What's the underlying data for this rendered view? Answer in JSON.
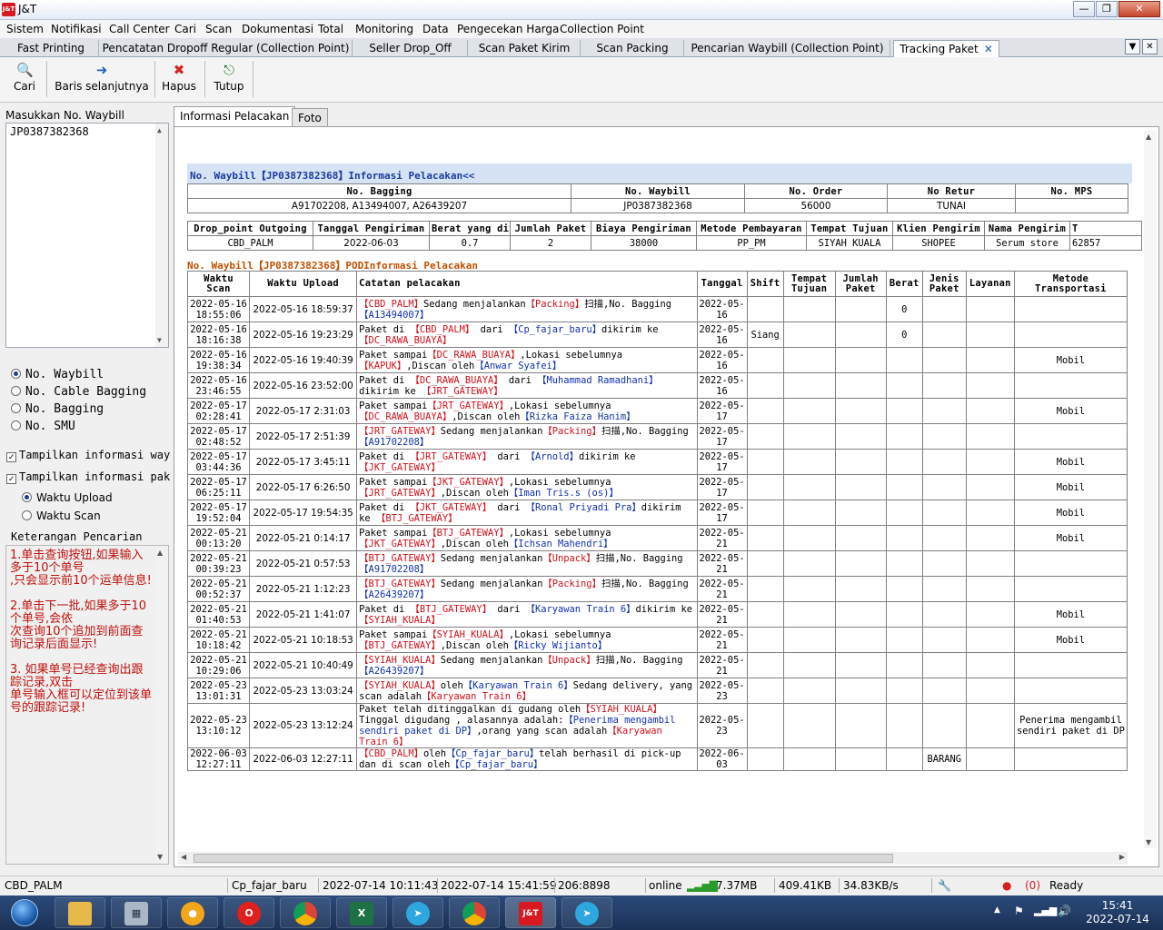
{
  "window": {
    "title": "J&T",
    "logo": "J&T"
  },
  "menu": [
    "Sistem",
    "Notifikasi",
    "Call Center",
    "Cari",
    "Scan",
    "Dokumentasi",
    "Total",
    "Monitoring",
    "Data",
    "Pengecekan Harga",
    "Collection Point"
  ],
  "doc_tabs": [
    "Fast Printing",
    "Pencatatan Dropoff Regular (Collection Point)",
    "Seller Drop_Off",
    "Scan Paket Kirim",
    "Scan Packing",
    "Pencarian Waybill (Collection Point)",
    "Tracking Paket"
  ],
  "toolbar": {
    "cari": "Cari",
    "baris": "Baris selanjutnya",
    "hapus": "Hapus",
    "tutup": "Tutup"
  },
  "left": {
    "label": "Masukkan No. Waybill",
    "input_value": "JP0387382368",
    "radio1": [
      "No. Waybill",
      "No. Cable Bagging",
      "No. Bagging",
      "No. SMU"
    ],
    "check1": "Tampilkan informasi waybill",
    "check2": "Tampilkan informasi paket",
    "radio2": [
      "Waktu Upload",
      "Waktu Scan"
    ],
    "hint_title": "Keterangan Pencarian",
    "hint_text": "1.单击查询按钮,如果输入多于10个单号\n,只会显示前10个运单信息!\n\n2.单击下一批,如果多于10个单号,会依\n次查询10个追加到前面查询记录后面显示!\n\n3. 如果单号已经查询出跟踪记录,双击\n单号输入框可以定位到该单号的跟踪记录!"
  },
  "inner_tabs": [
    "Informasi Pelacakan",
    "Foto"
  ],
  "section1_title": "No. Waybill【JP0387382368】Informasi Pelacakan<<",
  "info1": {
    "headers": [
      "No. Bagging",
      "No. Waybill",
      "No. Order",
      "No Retur",
      "No. MPS"
    ],
    "values": [
      "A91702208, A13494007, A26439207",
      "JP0387382368",
      "56000",
      "TUNAI",
      ""
    ]
  },
  "info2": {
    "headers": [
      "Drop_point Outgoing",
      "Tanggal Pengiriman",
      "Berat yang ditagih",
      "Jumlah Paket",
      "Biaya Pengiriman",
      "Metode Pembayaran",
      "Tempat Tujuan",
      "Klien Pengirim",
      "Nama Pengirim",
      "T"
    ],
    "values": [
      "CBD_PALM",
      "2022-06-03",
      "0.7",
      "2",
      "38000",
      "PP_PM",
      "SIYAH KUALA",
      "SHOPEE",
      "Serum store",
      "62857"
    ]
  },
  "section2_title": "No. Waybill【JP0387382368】PODInformasi Pelacakan",
  "tracking": {
    "headers": [
      "Waktu Scan",
      "Waktu Upload",
      "Catatan pelacakan",
      "Tanggal",
      "Shift",
      "Tempat Tujuan",
      "Jumlah Paket",
      "Berat",
      "Jenis Paket",
      "Layanan",
      "Metode Transportasi"
    ],
    "rows": [
      {
        "scan": "2022-05-16 18:55:06",
        "upload": "2022-05-16 18:59:37",
        "note": [
          [
            "r",
            "【CBD_PALM】"
          ],
          [
            "",
            "Sedang menjalankan"
          ],
          [
            "r",
            "【Packing】"
          ],
          [
            "",
            "扫描,No. Bagging"
          ],
          [
            "b",
            "【A13494007】"
          ]
        ],
        "tanggal": "2022-05-16",
        "shift": "",
        "tujuan": "",
        "jumlah": "",
        "berat": "0",
        "jenis": "",
        "layanan": "",
        "metode": ""
      },
      {
        "scan": "2022-05-16 18:16:38",
        "upload": "2022-05-16 19:23:29",
        "note": [
          [
            "",
            "Paket di "
          ],
          [
            "r",
            "【CBD_PALM】"
          ],
          [
            "",
            " dari "
          ],
          [
            "b",
            "【Cp_fajar_baru】"
          ],
          [
            "",
            "dikirim ke "
          ],
          [
            "r",
            "【DC_RAWA_BUAYA】"
          ]
        ],
        "tanggal": "2022-05-16",
        "shift": "Siang",
        "tujuan": "",
        "jumlah": "",
        "berat": "0",
        "jenis": "",
        "layanan": "",
        "metode": ""
      },
      {
        "scan": "2022-05-16 19:38:34",
        "upload": "2022-05-16 19:40:39",
        "note": [
          [
            "",
            "Paket sampai"
          ],
          [
            "r",
            "【DC_RAWA_BUAYA】"
          ],
          [
            "",
            ",Lokasi sebelumnya "
          ],
          [
            "r",
            "【KAPUK】"
          ],
          [
            "",
            ",Discan oleh"
          ],
          [
            "b",
            "【Anwar Syafei】"
          ]
        ],
        "tanggal": "2022-05-16",
        "shift": "",
        "tujuan": "",
        "jumlah": "",
        "berat": "",
        "jenis": "",
        "layanan": "",
        "metode": "Mobil"
      },
      {
        "scan": "2022-05-16 23:46:55",
        "upload": "2022-05-16 23:52:00",
        "note": [
          [
            "",
            "Paket di "
          ],
          [
            "r",
            "【DC_RAWA_BUAYA】"
          ],
          [
            "",
            " dari "
          ],
          [
            "b",
            "【Muhammad Ramadhani】"
          ],
          [
            "",
            "dikirim ke "
          ],
          [
            "r",
            "【JRT_GATEWAY】"
          ]
        ],
        "tanggal": "2022-05-16",
        "shift": "",
        "tujuan": "",
        "jumlah": "",
        "berat": "",
        "jenis": "",
        "layanan": "",
        "metode": ""
      },
      {
        "scan": "2022-05-17 02:28:41",
        "upload": "2022-05-17 2:31:03",
        "note": [
          [
            "",
            "Paket sampai"
          ],
          [
            "r",
            "【JRT_GATEWAY】"
          ],
          [
            "",
            ",Lokasi sebelumnya "
          ],
          [
            "r",
            "【DC_RAWA_BUAYA】"
          ],
          [
            "",
            ",Discan oleh"
          ],
          [
            "b",
            "【Rizka Faiza Hanim】"
          ]
        ],
        "tanggal": "2022-05-17",
        "shift": "",
        "tujuan": "",
        "jumlah": "",
        "berat": "",
        "jenis": "",
        "layanan": "",
        "metode": "Mobil"
      },
      {
        "scan": "2022-05-17 02:48:52",
        "upload": "2022-05-17 2:51:39",
        "note": [
          [
            "r",
            "【JRT_GATEWAY】"
          ],
          [
            "",
            "Sedang menjalankan"
          ],
          [
            "r",
            "【Packing】"
          ],
          [
            "",
            "扫描,No. Bagging"
          ],
          [
            "b",
            "【A91702208】"
          ]
        ],
        "tanggal": "2022-05-17",
        "shift": "",
        "tujuan": "",
        "jumlah": "",
        "berat": "",
        "jenis": "",
        "layanan": "",
        "metode": ""
      },
      {
        "scan": "2022-05-17 03:44:36",
        "upload": "2022-05-17 3:45:11",
        "note": [
          [
            "",
            "Paket di "
          ],
          [
            "r",
            "【JRT_GATEWAY】"
          ],
          [
            "",
            " dari "
          ],
          [
            "b",
            "【Arnold】"
          ],
          [
            "",
            "dikirim ke "
          ],
          [
            "r",
            "【JKT_GATEWAY】"
          ]
        ],
        "tanggal": "2022-05-17",
        "shift": "",
        "tujuan": "",
        "jumlah": "",
        "berat": "",
        "jenis": "",
        "layanan": "",
        "metode": "Mobil"
      },
      {
        "scan": "2022-05-17 06:25:11",
        "upload": "2022-05-17 6:26:50",
        "note": [
          [
            "",
            "Paket sampai"
          ],
          [
            "r",
            "【JKT_GATEWAY】"
          ],
          [
            "",
            ",Lokasi sebelumnya "
          ],
          [
            "r",
            "【JRT_GATEWAY】"
          ],
          [
            "",
            ",Discan oleh"
          ],
          [
            "b",
            "【Iman Tris.s (os)】"
          ]
        ],
        "tanggal": "2022-05-17",
        "shift": "",
        "tujuan": "",
        "jumlah": "",
        "berat": "",
        "jenis": "",
        "layanan": "",
        "metode": "Mobil"
      },
      {
        "scan": "2022-05-17 19:52:04",
        "upload": "2022-05-17 19:54:35",
        "note": [
          [
            "",
            "Paket di "
          ],
          [
            "r",
            "【JKT_GATEWAY】"
          ],
          [
            "",
            " dari "
          ],
          [
            "b",
            "【Ronal Priyadi Pra】"
          ],
          [
            "",
            "dikirim ke "
          ],
          [
            "r",
            "【BTJ_GATEWAY】"
          ]
        ],
        "tanggal": "2022-05-17",
        "shift": "",
        "tujuan": "",
        "jumlah": "",
        "berat": "",
        "jenis": "",
        "layanan": "",
        "metode": "Mobil"
      },
      {
        "scan": "2022-05-21 00:13:20",
        "upload": "2022-05-21 0:14:17",
        "note": [
          [
            "",
            "Paket sampai"
          ],
          [
            "r",
            "【BTJ_GATEWAY】"
          ],
          [
            "",
            ",Lokasi sebelumnya "
          ],
          [
            "r",
            "【JKT_GATEWAY】"
          ],
          [
            "",
            ",Discan oleh"
          ],
          [
            "b",
            "【Ichsan Mahendri】"
          ]
        ],
        "tanggal": "2022-05-21",
        "shift": "",
        "tujuan": "",
        "jumlah": "",
        "berat": "",
        "jenis": "",
        "layanan": "",
        "metode": "Mobil"
      },
      {
        "scan": "2022-05-21 00:39:23",
        "upload": "2022-05-21 0:57:53",
        "note": [
          [
            "r",
            "【BTJ_GATEWAY】"
          ],
          [
            "",
            "Sedang menjalankan"
          ],
          [
            "r",
            "【Unpack】"
          ],
          [
            "",
            "扫描,No. Bagging"
          ],
          [
            "b",
            "【A91702208】"
          ]
        ],
        "tanggal": "2022-05-21",
        "shift": "",
        "tujuan": "",
        "jumlah": "",
        "berat": "",
        "jenis": "",
        "layanan": "",
        "metode": ""
      },
      {
        "scan": "2022-05-21 00:52:37",
        "upload": "2022-05-21 1:12:23",
        "note": [
          [
            "r",
            "【BTJ_GATEWAY】"
          ],
          [
            "",
            "Sedang menjalankan"
          ],
          [
            "r",
            "【Packing】"
          ],
          [
            "",
            "扫描,No. Bagging"
          ],
          [
            "b",
            "【A26439207】"
          ]
        ],
        "tanggal": "2022-05-21",
        "shift": "",
        "tujuan": "",
        "jumlah": "",
        "berat": "",
        "jenis": "",
        "layanan": "",
        "metode": ""
      },
      {
        "scan": "2022-05-21 01:40:53",
        "upload": "2022-05-21 1:41:07",
        "note": [
          [
            "",
            "Paket di "
          ],
          [
            "r",
            "【BTJ_GATEWAY】"
          ],
          [
            "",
            " dari "
          ],
          [
            "b",
            "【Karyawan Train 6】"
          ],
          [
            "",
            "dikirim ke "
          ],
          [
            "r",
            "【SYIAH_KUALA】"
          ]
        ],
        "tanggal": "2022-05-21",
        "shift": "",
        "tujuan": "",
        "jumlah": "",
        "berat": "",
        "jenis": "",
        "layanan": "",
        "metode": "Mobil"
      },
      {
        "scan": "2022-05-21 10:18:42",
        "upload": "2022-05-21 10:18:53",
        "note": [
          [
            "",
            "Paket sampai"
          ],
          [
            "r",
            "【SYIAH_KUALA】"
          ],
          [
            "",
            ",Lokasi sebelumnya "
          ],
          [
            "r",
            "【BTJ_GATEWAY】"
          ],
          [
            "",
            ",Discan oleh"
          ],
          [
            "b",
            "【Ricky Wijianto】"
          ]
        ],
        "tanggal": "2022-05-21",
        "shift": "",
        "tujuan": "",
        "jumlah": "",
        "berat": "",
        "jenis": "",
        "layanan": "",
        "metode": "Mobil"
      },
      {
        "scan": "2022-05-21 10:29:06",
        "upload": "2022-05-21 10:40:49",
        "note": [
          [
            "r",
            "【SYIAH_KUALA】"
          ],
          [
            "",
            "Sedang menjalankan"
          ],
          [
            "r",
            "【Unpack】"
          ],
          [
            "",
            "扫描,No. Bagging"
          ],
          [
            "b",
            "【A26439207】"
          ]
        ],
        "tanggal": "2022-05-21",
        "shift": "",
        "tujuan": "",
        "jumlah": "",
        "berat": "",
        "jenis": "",
        "layanan": "",
        "metode": ""
      },
      {
        "scan": "2022-05-23 13:01:31",
        "upload": "2022-05-23 13:03:24",
        "note": [
          [
            "r",
            "【SYIAH_KUALA】"
          ],
          [
            "",
            "oleh"
          ],
          [
            "b",
            "【Karyawan Train 6】"
          ],
          [
            "",
            "Sedang delivery, yang scan adalah"
          ],
          [
            "r",
            "【Karyawan Train 6】"
          ]
        ],
        "tanggal": "2022-05-23",
        "shift": "",
        "tujuan": "",
        "jumlah": "",
        "berat": "",
        "jenis": "",
        "layanan": "",
        "metode": ""
      },
      {
        "scan": "2022-05-23 13:10:12",
        "upload": "2022-05-23 13:12:24",
        "note": [
          [
            "",
            "Paket telah ditinggalkan di gudang oleh"
          ],
          [
            "r",
            "【SYIAH_KUALA】"
          ],
          [
            "",
            "Tinggal digudang , alasannya adalah:"
          ],
          [
            "b",
            "【Penerima mengambil sendiri paket di DP】"
          ],
          [
            "",
            ",orang yang scan adalah"
          ],
          [
            "r",
            "【Karyawan Train 6】"
          ]
        ],
        "tanggal": "2022-05-23",
        "shift": "",
        "tujuan": "",
        "jumlah": "",
        "berat": "",
        "jenis": "",
        "layanan": "",
        "metode": "Penerima mengambil sendiri paket di DP"
      },
      {
        "scan": "2022-06-03 12:27:11",
        "upload": "2022-06-03 12:27:11",
        "note": [
          [
            "r",
            "【CBD_PALM】"
          ],
          [
            "",
            "oleh"
          ],
          [
            "b",
            "【Cp_fajar_baru】"
          ],
          [
            "",
            "telah berhasil di pick-up dan di scan oleh"
          ],
          [
            "b",
            "【Cp_fajar_baru】"
          ]
        ],
        "tanggal": "2022-06-03",
        "shift": "",
        "tujuan": "",
        "jumlah": "",
        "berat": "",
        "jenis": "BARANG",
        "layanan": "",
        "metode": ""
      }
    ]
  },
  "status": {
    "site": "CBD_PALM",
    "user": "Cp_fajar_baru",
    "t1": "2022-07-14 10:11:43",
    "t2": "2022-07-14 15:41:59",
    "port": "206:8898",
    "online": "online",
    "mem": "7.37MB",
    "down": "409.41KB",
    "speed": "34.83KB/s",
    "alerts": "(0)",
    "ready": "Ready"
  },
  "clock": {
    "time": "15:41",
    "date": "2022-07-14"
  },
  "colors": {
    "accent": "#1a3aa0",
    "red_text": "#d0101a",
    "blue_text": "#1030b0",
    "hint_red": "#c0100c"
  }
}
